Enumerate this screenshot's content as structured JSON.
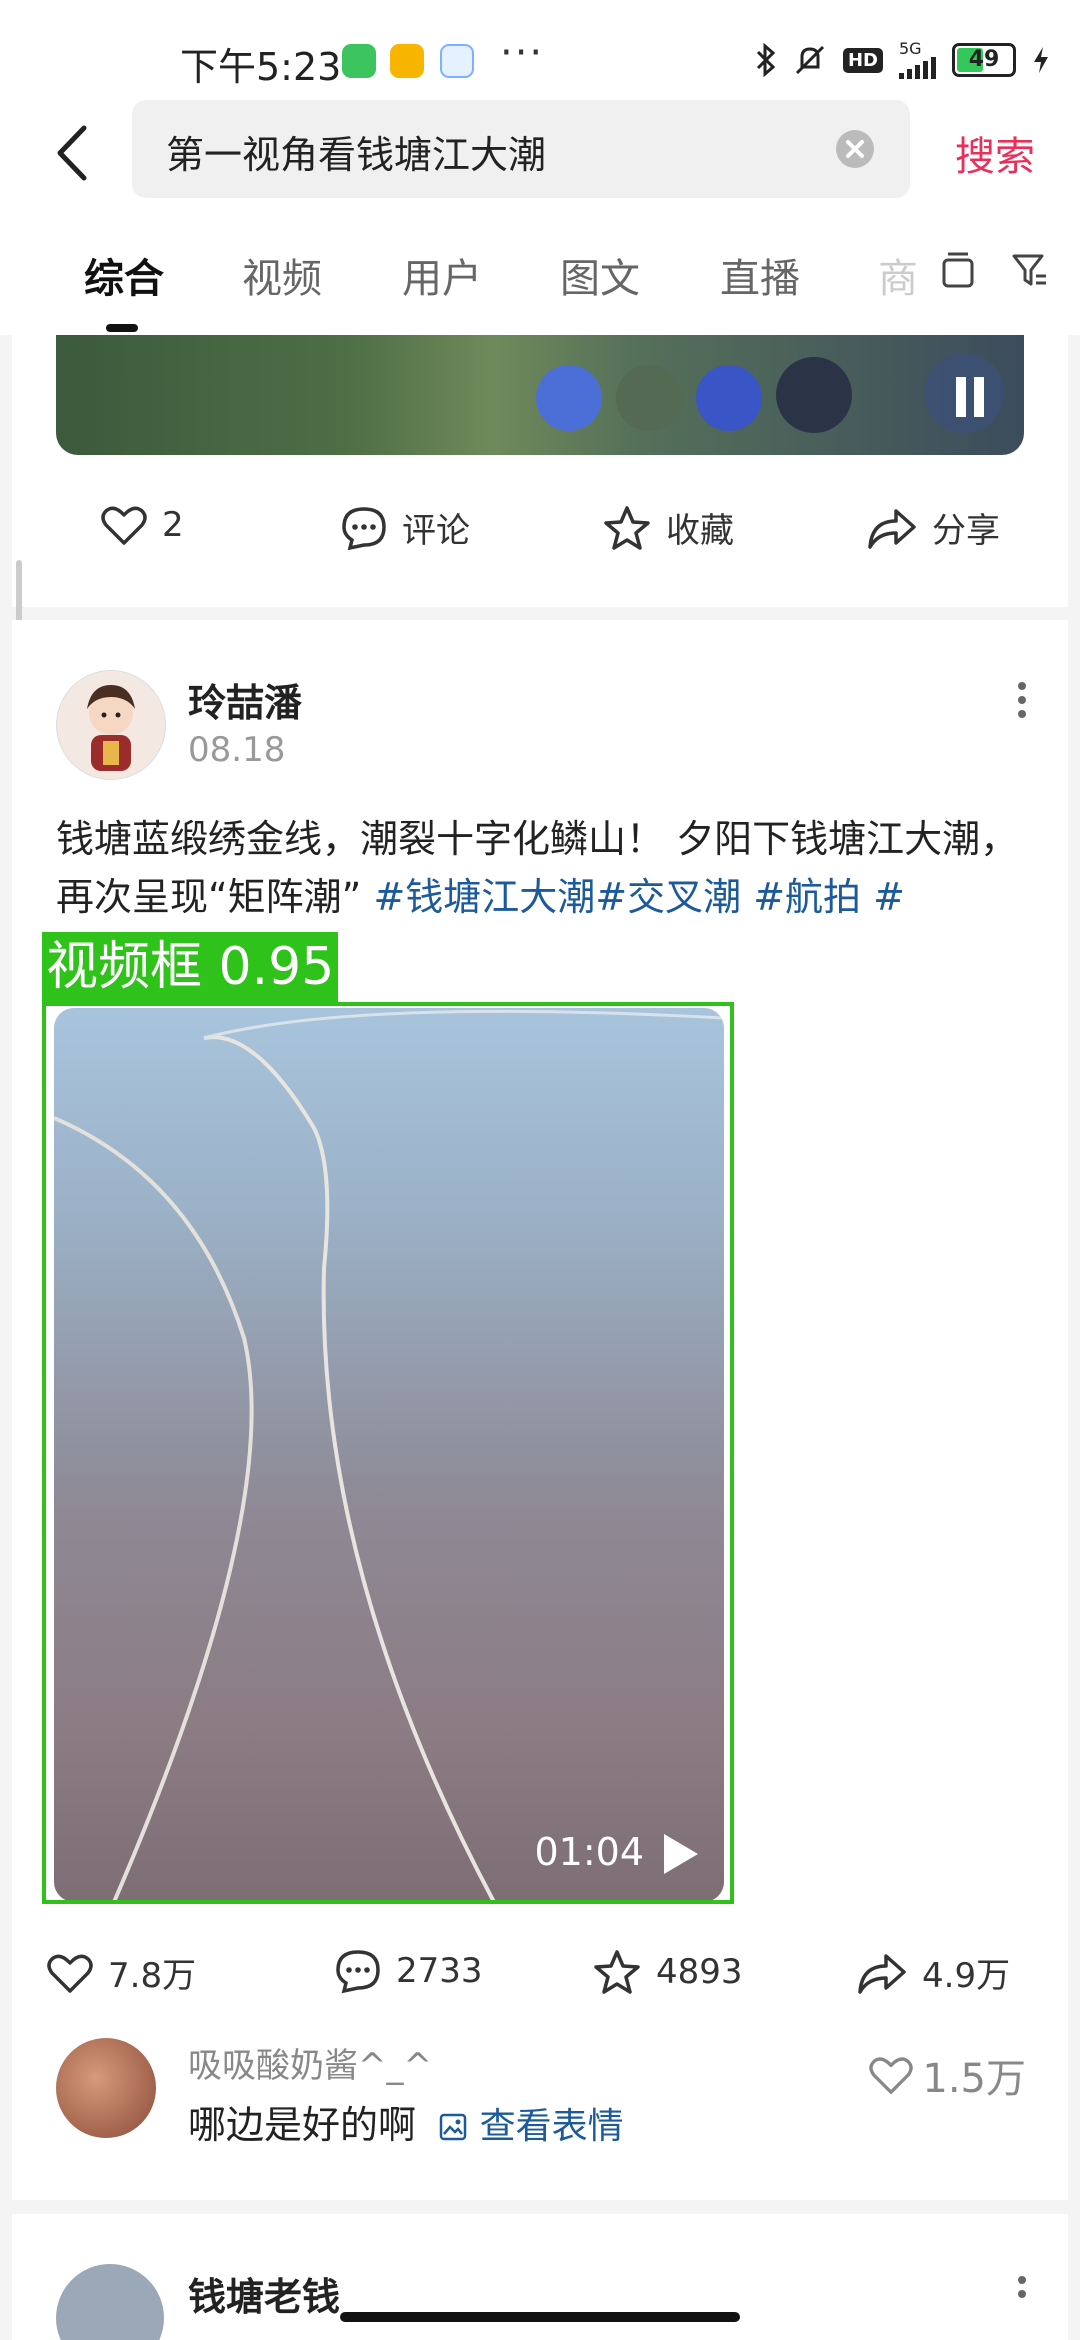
{
  "status_bar": {
    "time": "下午5:23",
    "network": "5G",
    "battery": "49",
    "hd": "HD",
    "dots": "···",
    "icons": [
      "wechat-icon",
      "58-icon",
      "app-icon",
      "bluetooth-icon",
      "mute-icon",
      "signal-icon",
      "charging-icon"
    ]
  },
  "search": {
    "query": "第一视角看钱塘江大潮",
    "button": "搜索"
  },
  "tabs": [
    {
      "label": "综合",
      "active": true
    },
    {
      "label": "视频"
    },
    {
      "label": "用户"
    },
    {
      "label": "图文"
    },
    {
      "label": "直播"
    },
    {
      "label": "商"
    }
  ],
  "card1": {
    "likes": "2",
    "comment": "评论",
    "favorite": "收藏",
    "share": "分享"
  },
  "post": {
    "author": "玲喆潘",
    "date": "08.18",
    "text": "钱塘蓝缎绣金线，潮裂十字化鳞山！ 夕阳下钱塘江大潮，再次呈现“矩阵潮” ",
    "tags": "#钱塘江大潮#交叉潮 #航拍 #",
    "detect_label": "视频框 0.95",
    "duration": "01:04",
    "likes": "7.8万",
    "comments": "2733",
    "favorites": "4893",
    "shares": "4.9万"
  },
  "comment": {
    "user": "吸吸酸奶酱^_^",
    "text": "哪边是好的啊",
    "link": "查看表情",
    "likes": "1.5万"
  },
  "card3": {
    "author": "钱塘老钱"
  },
  "colors": {
    "accent": "#e8315a",
    "tag": "#1c5a9a",
    "detect": "#2ec21a"
  }
}
